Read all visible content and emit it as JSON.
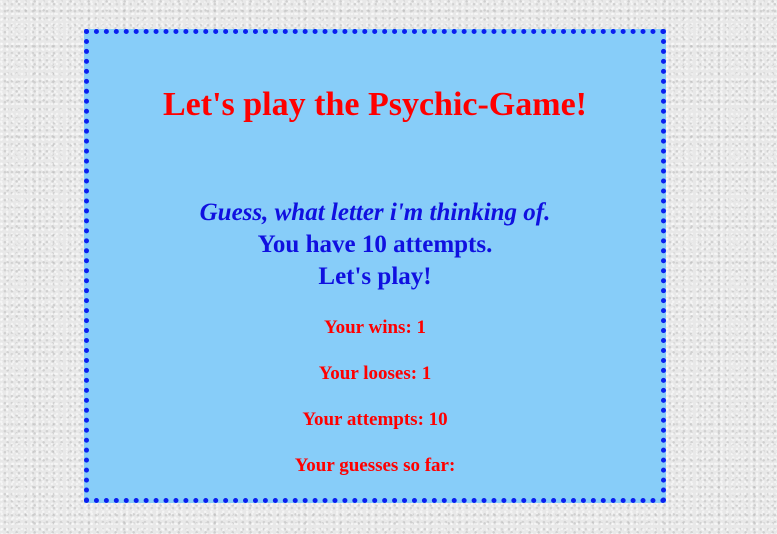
{
  "game": {
    "title": "Let's play the Psychic-Game!",
    "instruction": "Guess, what letter i'm thinking of.",
    "attempts_info": "You have 10 attempts.",
    "lets_play": "Let's play!",
    "wins_text": "Your wins: 1",
    "looses_text": "Your looses: 1",
    "attempts_text": "Your attempts: 10",
    "guesses_text": "Your guesses so far:"
  },
  "colors": {
    "panel_background": "#87cdf9",
    "panel_border": "#0a1ef0",
    "title": "#ff0000",
    "intro_text": "#1010e0",
    "stats_text": "#ff0000",
    "page_background": "#e8e8e8"
  }
}
